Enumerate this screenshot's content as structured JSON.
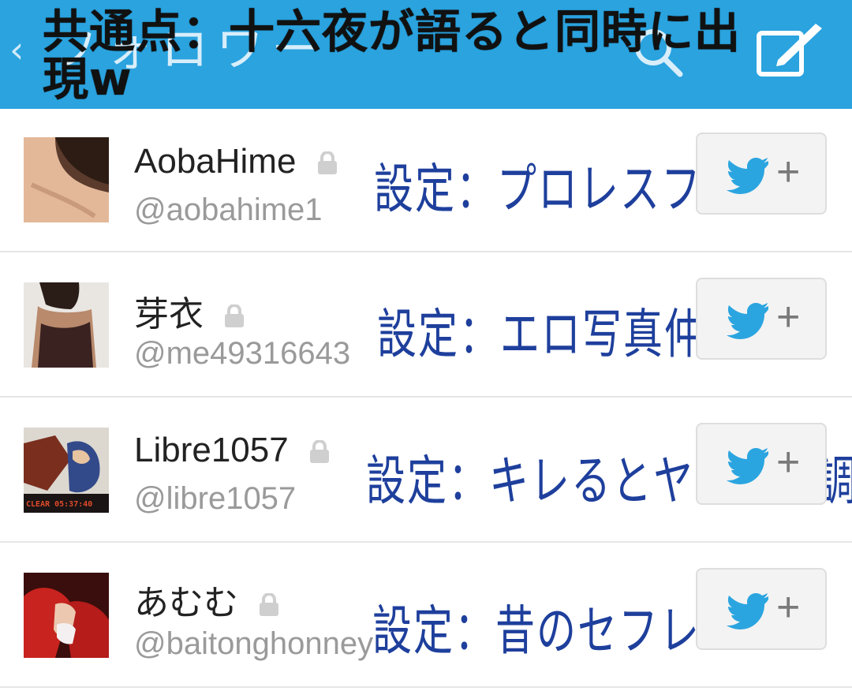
{
  "header": {
    "background_color": "#2aa3df",
    "underlying_title": "フォロワー",
    "caption": "共通点：十六夜が語ると同時に出現w"
  },
  "users": [
    {
      "name": "AobaHime",
      "handle": "@aobahime1",
      "note": "設定：プロレスファン",
      "protected": true,
      "follow_icon": "twitter-bird-plus-icon"
    },
    {
      "name": "芽衣",
      "handle": "@me49316643",
      "note": "設定：エロ写真仲間",
      "protected": true,
      "follow_icon": "twitter-bird-plus-icon"
    },
    {
      "name": "Libre1057",
      "handle": "@libre1057",
      "note": "設定：キレるとヤクザロ調",
      "protected": true,
      "avatar_text": "CLEAR  05:37:40",
      "follow_icon": "twitter-bird-plus-icon"
    },
    {
      "name": "あむむ",
      "handle": "@baitonghonney",
      "note": "設定：昔のセフレ",
      "protected": true,
      "follow_icon": "twitter-bird-plus-icon"
    }
  ],
  "colors": {
    "accent": "#2aa3df",
    "note_ink": "#1e3f9c",
    "twitter_blue": "#2ba5e0"
  }
}
